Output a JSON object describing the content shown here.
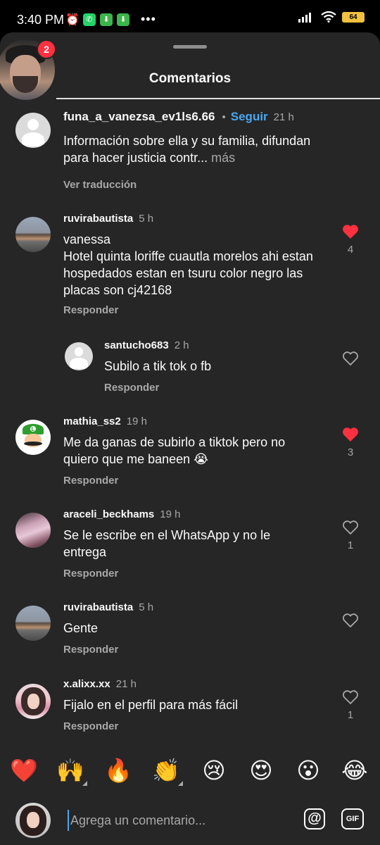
{
  "status_bar": {
    "time": "3:40 PM",
    "battery": "64"
  },
  "sheet": {
    "title": "Comentarios",
    "notification_count": "2"
  },
  "comments": [
    {
      "username": "funa_a_vanezsa_ev1ls6.66",
      "follow": "Seguir",
      "time": "21 h",
      "text": "Información sobre ella y su familia, difundan para hacer justicia contr...",
      "more": " más",
      "action": "Ver traducción"
    },
    {
      "username": "ruvirabautista",
      "time": "5 h",
      "text": "vanessa\nHotel quinta loriffe cuautla morelos ahi estan hospedados estan en tsuru color negro las placas son cj42168",
      "action": "Responder",
      "likes": "4",
      "liked": true
    },
    {
      "username": "santucho683",
      "time": "2 h",
      "text": "Subilo a tik tok o fb",
      "action": "Responder",
      "likes": "",
      "liked": false
    },
    {
      "username": "mathia_ss2",
      "time": "19 h",
      "text": "Me da ganas de subirlo a tiktok pero no quiero que me baneen 😭",
      "action": "Responder",
      "likes": "3",
      "liked": true
    },
    {
      "username": "araceli_beckhams",
      "time": "19 h",
      "text": "Se le escribe en el WhatsApp y no le entrega",
      "action": "Responder",
      "likes": "1",
      "liked": false
    },
    {
      "username": "ruvirabautista",
      "time": "5 h",
      "text": "Gente",
      "action": "Responder",
      "likes": "",
      "liked": false
    },
    {
      "username": "x.alixx.xx",
      "time": "21 h",
      "text": "Fijalo en el perfil para más fácil",
      "action": "Responder",
      "likes": "1",
      "liked": false
    }
  ],
  "quick_reactions": [
    "❤️",
    "🙌",
    "🔥",
    "👏",
    "😢",
    "😍",
    "😮",
    "😂"
  ],
  "composer": {
    "placeholder": "Agrega un comentario...",
    "mention_icon": "@",
    "gif_label": "GIF"
  },
  "colors": {
    "like_red": "#ff3040",
    "link_blue": "#4aa8f0",
    "sheet_bg": "#262626"
  }
}
